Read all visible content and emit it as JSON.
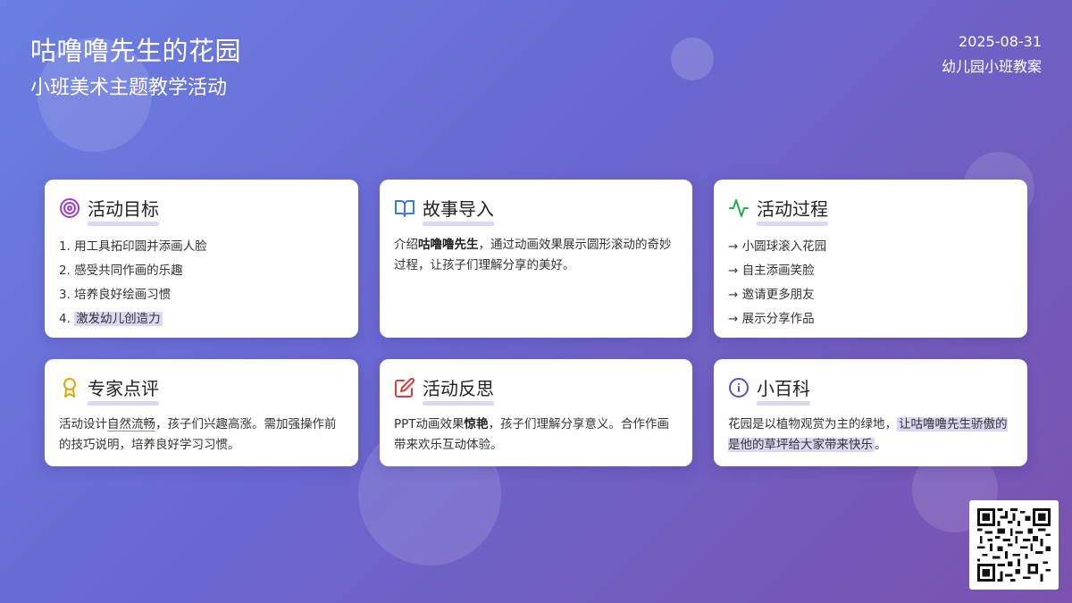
{
  "header": {
    "title": "咕噜噜先生的花园",
    "subtitle": "小班美术主题教学活动",
    "date": "2025-08-31",
    "plan_label": "幼儿园小班教案"
  },
  "cards": {
    "goals": {
      "title": "活动目标",
      "icon": "target-icon",
      "items": [
        "1. 用工具拓印圆并添画人脸",
        "2. 感受共同作画的乐趣",
        "3. 培养良好绘画习惯",
        "4. "
      ],
      "highlight": "激发幼儿创造力"
    },
    "story": {
      "title": "故事导入",
      "icon": "book-icon",
      "text_prefix": "介绍",
      "text_bold": "咕噜噜先生",
      "text_rest": "，通过动画效果展示圆形滚动的奇妙过程，让孩子们理解分享的美好。"
    },
    "process": {
      "title": "活动过程",
      "icon": "activity-icon",
      "steps": [
        "→ 小圆球滚入花园",
        "→ 自主添画笑脸",
        "→ 邀请更多朋友",
        "→ 展示分享作品"
      ]
    },
    "review": {
      "title": "专家点评",
      "icon": "award-icon",
      "text_prefix": "活动设计",
      "text_underline": "自然流畅",
      "text_rest": "，孩子们兴趣高涨。需加强操作前的技巧说明，培养良好学习习惯。"
    },
    "reflection": {
      "title": "活动反思",
      "icon": "edit-icon",
      "text_prefix": "PPT动画效果",
      "text_bold": "惊艳",
      "text_rest": "，孩子们理解分享意义。合作作画带来欢乐互动体验。"
    },
    "wiki": {
      "title": "小百科",
      "icon": "info-icon",
      "text_prefix": "花园是以植物观赏为主的绿地，",
      "text_highlight": "让咕噜噜先生骄傲的是他的草坪给大家带来快乐",
      "text_rest": "。"
    }
  },
  "colors": {
    "goals_icon": "#9b3fd0",
    "story_icon": "#3a7bd5",
    "process_icon": "#22b14c",
    "review_icon": "#e0a800",
    "reflection_icon": "#e03c3c",
    "wiki_icon": "#5b4fc9"
  },
  "qr": {
    "icon": "qr-code-icon"
  }
}
